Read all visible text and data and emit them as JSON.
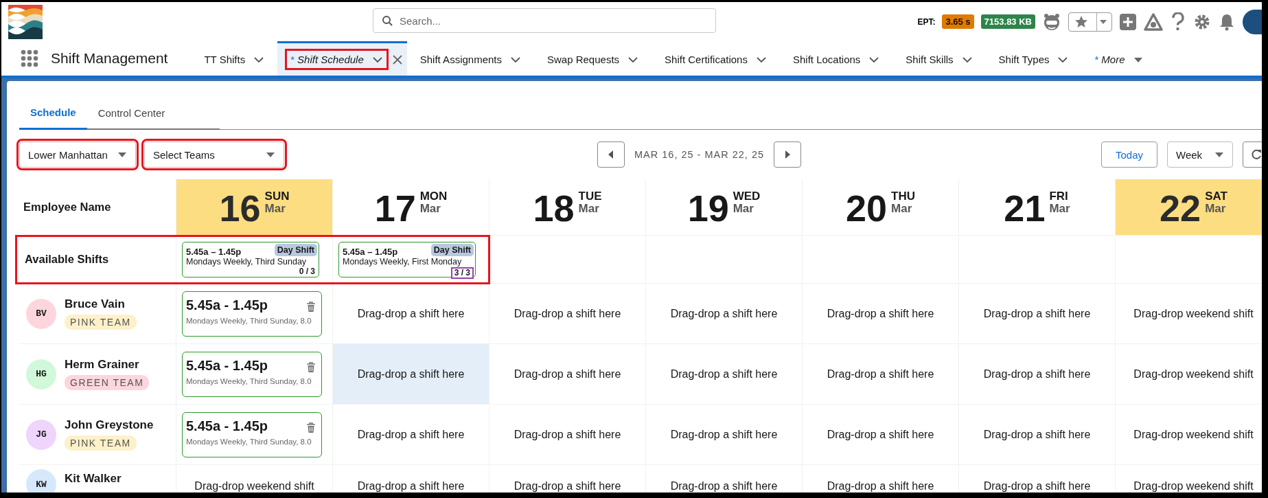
{
  "search": {
    "placeholder": "Search..."
  },
  "ept": {
    "label": "EPT:",
    "time": "3.65 s",
    "memory": "7153.83 KB"
  },
  "app_name": "Shift Management",
  "nav_tabs": [
    {
      "kind": "tab",
      "label": "TT Shifts",
      "selected": false
    },
    {
      "kind": "tab",
      "label": "Shift Schedule",
      "marker": "*",
      "selected": true,
      "highlight": {
        "color": "#e8141c"
      }
    },
    {
      "kind": "tab",
      "label": "Shift Assignments",
      "selected": false
    },
    {
      "kind": "tab",
      "label": "Swap Requests",
      "selected": false
    },
    {
      "kind": "tab",
      "label": "Shift Certifications",
      "selected": false
    },
    {
      "kind": "tab",
      "label": "Shift Locations",
      "selected": false
    },
    {
      "kind": "tab",
      "label": "Shift Skills",
      "selected": false
    },
    {
      "kind": "tab",
      "label": "Shift Types",
      "selected": false
    },
    {
      "kind": "more",
      "label": "More",
      "marker": "*",
      "selected": false
    }
  ],
  "page_tabs": [
    {
      "label": "Schedule",
      "selected": true
    },
    {
      "label": "Control Center",
      "selected": false
    }
  ],
  "filters": [
    {
      "value": "Lower Manhattan",
      "highlight": {
        "color": "#e8141c"
      }
    },
    {
      "value": "Select Teams",
      "highlight": {
        "color": "#e8141c"
      }
    }
  ],
  "date_range": "MAR 16, 25 - MAR 22, 25",
  "today_button": "Today",
  "view": {
    "value": "Week"
  },
  "grid": {
    "name_header": "Employee Name",
    "days": [
      {
        "day": "16",
        "weekday": "SUN",
        "month": "Mar",
        "weekend": true
      },
      {
        "day": "17",
        "weekday": "MON",
        "month": "Mar",
        "weekend": false
      },
      {
        "day": "18",
        "weekday": "TUE",
        "month": "Mar",
        "weekend": false
      },
      {
        "day": "19",
        "weekday": "WED",
        "month": "Mar",
        "weekend": false
      },
      {
        "day": "20",
        "weekday": "THU",
        "month": "Mar",
        "weekend": false
      },
      {
        "day": "21",
        "weekday": "FRI",
        "month": "Mar",
        "weekend": false
      },
      {
        "day": "22",
        "weekday": "SAT",
        "month": "Mar",
        "weekend": true
      }
    ],
    "available": {
      "label": "Available Shifts",
      "highlight": {
        "color": "#e8141c"
      },
      "shifts": [
        {
          "time": "5.45a – 1.45p",
          "type": "Day Shift",
          "recurrence": "Mondays Weekly, Third Sunday",
          "count": {
            "text": "0 / 3"
          }
        },
        {
          "time": "5.45a – 1.45p",
          "type": "Day Shift",
          "recurrence": "Mondays Weekly, First Monday",
          "count": {
            "text": "3 / 3",
            "color": "#9b3fb5"
          }
        }
      ]
    },
    "employees": [
      {
        "avatar": {
          "initials": "BV",
          "color": "#fdd6dd"
        },
        "name": "Bruce Vain",
        "team": {
          "label": "PINK TEAM",
          "color": "#fdf1c9"
        },
        "cells": [
          {
            "kind": "shift",
            "time": "5.45a - 1.45p",
            "detail": "Mondays Weekly, Third Sunday, 8.0",
            "highlighted": false
          },
          {
            "kind": "drop",
            "text": "Drag-drop a shift here",
            "highlighted": false
          },
          {
            "kind": "drop",
            "text": "Drag-drop a shift here",
            "highlighted": false
          },
          {
            "kind": "drop",
            "text": "Drag-drop a shift here",
            "highlighted": false
          },
          {
            "kind": "drop",
            "text": "Drag-drop a shift here",
            "highlighted": false
          },
          {
            "kind": "drop",
            "text": "Drag-drop a shift here",
            "highlighted": false
          },
          {
            "kind": "drop",
            "text": "Drag-drop weekend shift",
            "highlighted": false
          }
        ]
      },
      {
        "avatar": {
          "initials": "HG",
          "color": "#d2f8da"
        },
        "name": "Herm Grainer",
        "team": {
          "label": "GREEN TEAM",
          "color": "#fdd6dd"
        },
        "cells": [
          {
            "kind": "shift",
            "time": "5.45a - 1.45p",
            "detail": "Mondays Weekly, Third Sunday, 8.0",
            "highlighted": false
          },
          {
            "kind": "drop",
            "text": "Drag-drop a shift here",
            "highlighted": true
          },
          {
            "kind": "drop",
            "text": "Drag-drop a shift here",
            "highlighted": false
          },
          {
            "kind": "drop",
            "text": "Drag-drop a shift here",
            "highlighted": false
          },
          {
            "kind": "drop",
            "text": "Drag-drop a shift here",
            "highlighted": false
          },
          {
            "kind": "drop",
            "text": "Drag-drop a shift here",
            "highlighted": false
          },
          {
            "kind": "drop",
            "text": "Drag-drop weekend shift",
            "highlighted": false
          }
        ]
      },
      {
        "avatar": {
          "initials": "JG",
          "color": "#efd4fb"
        },
        "name": "John Greystone",
        "team": {
          "label": "PINK TEAM",
          "color": "#fdf1c9"
        },
        "cells": [
          {
            "kind": "shift",
            "time": "5.45a - 1.45p",
            "detail": "Mondays Weekly, Third Sunday, 8.0",
            "highlighted": false
          },
          {
            "kind": "drop",
            "text": "Drag-drop a shift here",
            "highlighted": false
          },
          {
            "kind": "drop",
            "text": "Drag-drop a shift here",
            "highlighted": false
          },
          {
            "kind": "drop",
            "text": "Drag-drop a shift here",
            "highlighted": false
          },
          {
            "kind": "drop",
            "text": "Drag-drop a shift here",
            "highlighted": false
          },
          {
            "kind": "drop",
            "text": "Drag-drop a shift here",
            "highlighted": false
          },
          {
            "kind": "drop",
            "text": "Drag-drop weekend shift",
            "highlighted": false
          }
        ]
      },
      {
        "avatar": {
          "initials": "KW",
          "color": "#d6e9fc"
        },
        "name": "Kit Walker",
        "cells": [
          {
            "kind": "drop",
            "text": "Drag-drop weekend shift",
            "highlighted": false
          },
          {
            "kind": "drop",
            "text": "Drag-drop a shift here",
            "highlighted": false
          },
          {
            "kind": "drop",
            "text": "Drag-drop a shift here",
            "highlighted": false
          },
          {
            "kind": "drop",
            "text": "Drag-drop a shift here",
            "highlighted": false
          },
          {
            "kind": "drop",
            "text": "Drag-drop a shift here",
            "highlighted": false
          },
          {
            "kind": "drop",
            "text": "Drag-drop a shift here",
            "highlighted": false
          },
          {
            "kind": "drop",
            "text": "Drag-drop weekend shift",
            "highlighted": false
          }
        ]
      }
    ]
  }
}
